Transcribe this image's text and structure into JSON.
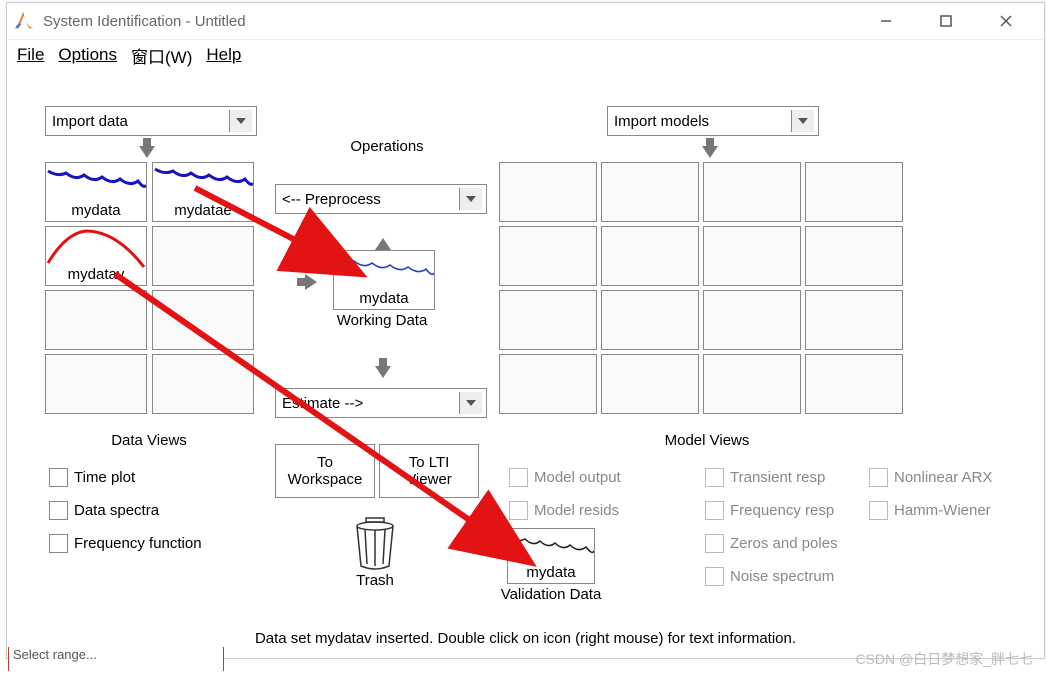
{
  "window": {
    "title": "System Identification - Untitled",
    "menu": {
      "file": "File",
      "options": "Options",
      "window": "窗口(W)",
      "help": "Help"
    },
    "buttons": {
      "minimize": "–",
      "maximize": "❐",
      "close": "✕"
    }
  },
  "dropdowns": {
    "import_data": "Import data",
    "preprocess": "<-- Preprocess",
    "estimate": "Estimate -->",
    "import_models": "Import models"
  },
  "labels": {
    "operations": "Operations",
    "data_views": "Data Views",
    "model_views": "Model Views",
    "working_data": "Working Data",
    "validation_data": "Validation Data",
    "trash": "Trash",
    "to_workspace": "To Workspace",
    "to_ltiviewer": "To LTI Viewer"
  },
  "data_slots": {
    "s1": "mydata",
    "s2": "mydatae",
    "s3": "mydatav"
  },
  "working_slot": "mydata",
  "validation_slot": "mydata",
  "data_views_checks": {
    "time_plot": "Time plot",
    "data_spectra": "Data spectra",
    "freq_func": "Frequency function"
  },
  "model_views_checks": {
    "c1": "Model output",
    "c2": "Model resids",
    "c3": "Transient resp",
    "c4": "Frequency resp",
    "c5": "Zeros and poles",
    "c6": "Noise spectrum",
    "c7": "Nonlinear ARX",
    "c8": "Hamm-Wiener"
  },
  "status": "Data set mydatav inserted.  Double click on icon (right mouse) for text information.",
  "watermark": "CSDN @白日梦想家_胖七七",
  "leftcut": {
    "t1": "Select range..."
  }
}
